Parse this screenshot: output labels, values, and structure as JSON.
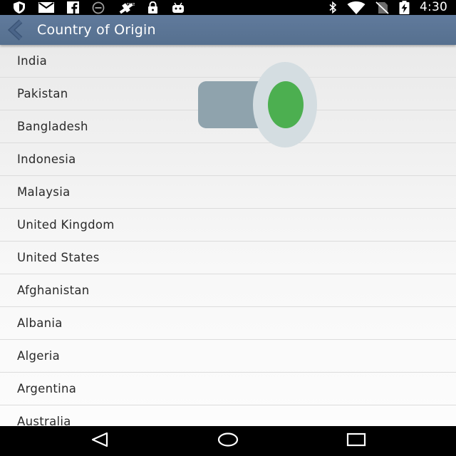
{
  "status_bar": {
    "time": "4:30",
    "left_icons": [
      "shield-icon",
      "email-icon",
      "facebook-icon",
      "blocked-circle-icon",
      "gps-icon",
      "lock-icon",
      "android-icon"
    ],
    "right_icons": [
      "bluetooth-icon",
      "wifi-icon",
      "no-sim-icon",
      "battery-charging-icon"
    ]
  },
  "app_bar": {
    "title": "Country of Origin",
    "color": "#5b7596"
  },
  "countries": [
    "India",
    "Pakistan",
    "Bangladesh",
    "Indonesia",
    "Malaysia",
    "United Kingdom",
    "United States",
    "Afghanistan",
    "Albania",
    "Algeria",
    "Argentina",
    "Australia"
  ],
  "overlay": {
    "icon": "toggle-switch-icon",
    "active_color": "#4caf50"
  },
  "nav_bar": {
    "buttons": [
      "back-triangle-icon",
      "home-circle-icon",
      "recents-square-icon"
    ]
  }
}
